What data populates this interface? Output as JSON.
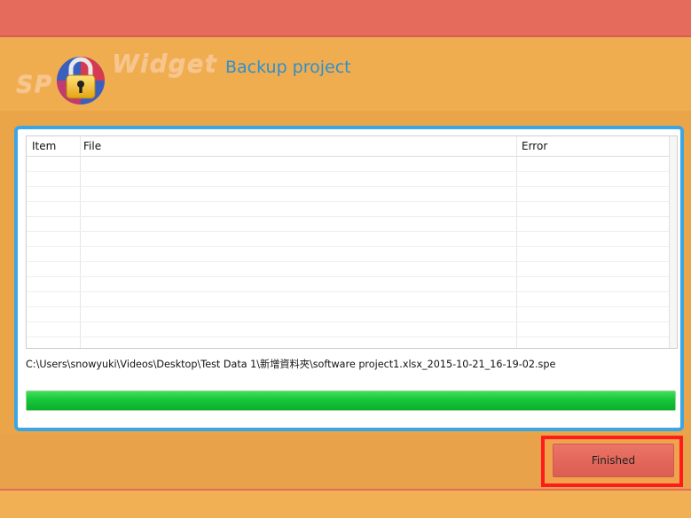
{
  "app": {
    "logo_text_left": "SP",
    "logo_text_right": "Widget",
    "title": "Backup project"
  },
  "table": {
    "columns": [
      "Item",
      "File",
      "Error"
    ],
    "rows": []
  },
  "status": {
    "current_path": "C:\\Users\\snowyuki\\Videos\\Desktop\\Test Data 1\\新增資料夾\\software project1.xlsx_2015-10-21_16-19-02.spe"
  },
  "progress": {
    "percent": 100
  },
  "actions": {
    "finished_label": "Finished"
  },
  "colors": {
    "accent_blue": "#3aa6e3",
    "title_blue": "#2d8fce",
    "top_bar_red": "#e56b5c",
    "background_orange": "#f0ad50",
    "progress_green": "#17c63a",
    "highlight_red": "#ff1b1b"
  },
  "icons": {
    "logo": "padlock-icon"
  }
}
